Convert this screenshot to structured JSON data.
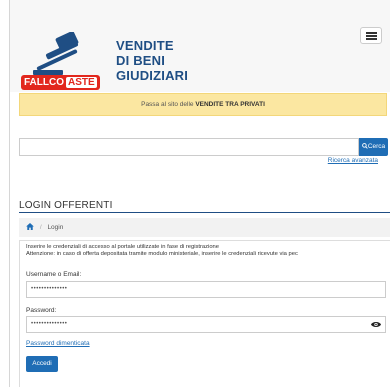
{
  "header": {
    "brand_fallco": "FALLCO",
    "brand_aste": "ASTE",
    "title_line1": "VENDITE",
    "title_line2": "DI BENI",
    "title_line3": "GIUDIZIARI"
  },
  "banner": {
    "text_prefix": "Passa al sito delle ",
    "text_bold": "VENDITE TRA PRIVATI"
  },
  "search": {
    "placeholder": "",
    "button_label": "Cerca",
    "advanced_link": "Ricerca avanzata"
  },
  "login": {
    "section_title": "LOGIN OFFERENTI",
    "breadcrumb_current": "Login",
    "info_line1": "Inserire le credenziali di accesso al portale utilizzate in fase di registrazione",
    "info_line2": "Attenzione: in caso di offerta depositata tramite modulo ministeriale, inserire le credenziali ricevute via pec",
    "username_label": "Username o Email:",
    "username_value": "••••••••••••••",
    "password_label": "Password:",
    "password_value": "••••••••••••••",
    "forgot_link": "Password dimenticata",
    "submit_label": "Accedi"
  },
  "colors": {
    "accent": "#1f6db5",
    "brand_red": "#e2271d",
    "title_blue": "#1f4e84",
    "banner_bg": "#fbe7a1"
  }
}
